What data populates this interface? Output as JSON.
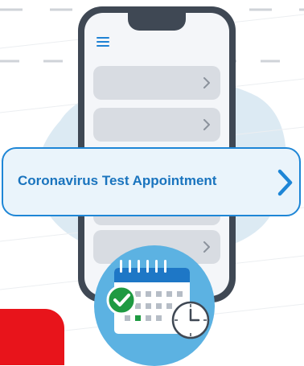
{
  "callout": {
    "label": "Coronavirus Test Appointment",
    "chevron_icon": "chevron-right-icon"
  },
  "phone": {
    "menu_icon": "hamburger-menu-icon",
    "list_item_count": 4
  },
  "badge": {
    "icons": [
      "calendar-icon",
      "checkmark-icon",
      "clock-icon"
    ]
  },
  "colors": {
    "accent_blue": "#1e86d6",
    "text_blue": "#1a74be",
    "phone_body": "#3f4854",
    "blob": "#dceaf3",
    "badge_bg": "#5cb2e2",
    "check_green": "#1f9a42",
    "red": "#e8141b"
  }
}
